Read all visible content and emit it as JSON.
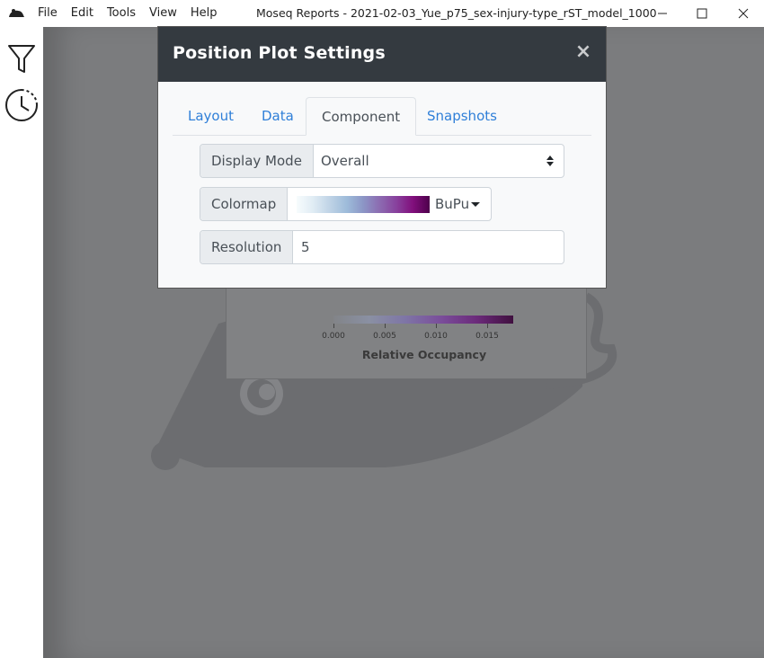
{
  "menu": [
    "File",
    "Edit",
    "Tools",
    "View",
    "Help"
  ],
  "window": {
    "title": "Moseq Reports - 2021-02-03_Yue_p75_sex-injury-type_rST_model_1000"
  },
  "sidebar": {
    "icons": [
      "filter-icon",
      "history-icon"
    ]
  },
  "modal": {
    "title": "Position Plot Settings",
    "close_label": "×",
    "tabs": [
      {
        "label": "Layout",
        "active": false
      },
      {
        "label": "Data",
        "active": false
      },
      {
        "label": "Component",
        "active": true
      },
      {
        "label": "Snapshots",
        "active": false
      }
    ],
    "fields": {
      "display_mode": {
        "label": "Display Mode",
        "value": "Overall"
      },
      "colormap": {
        "label": "Colormap",
        "value": "BuPu"
      },
      "resolution": {
        "label": "Resolution",
        "value": "5"
      }
    }
  },
  "background_plot": {
    "colorbar_ticks": [
      "0.000",
      "0.005",
      "0.010",
      "0.015"
    ],
    "colorbar_title": "Relative Occupancy"
  }
}
